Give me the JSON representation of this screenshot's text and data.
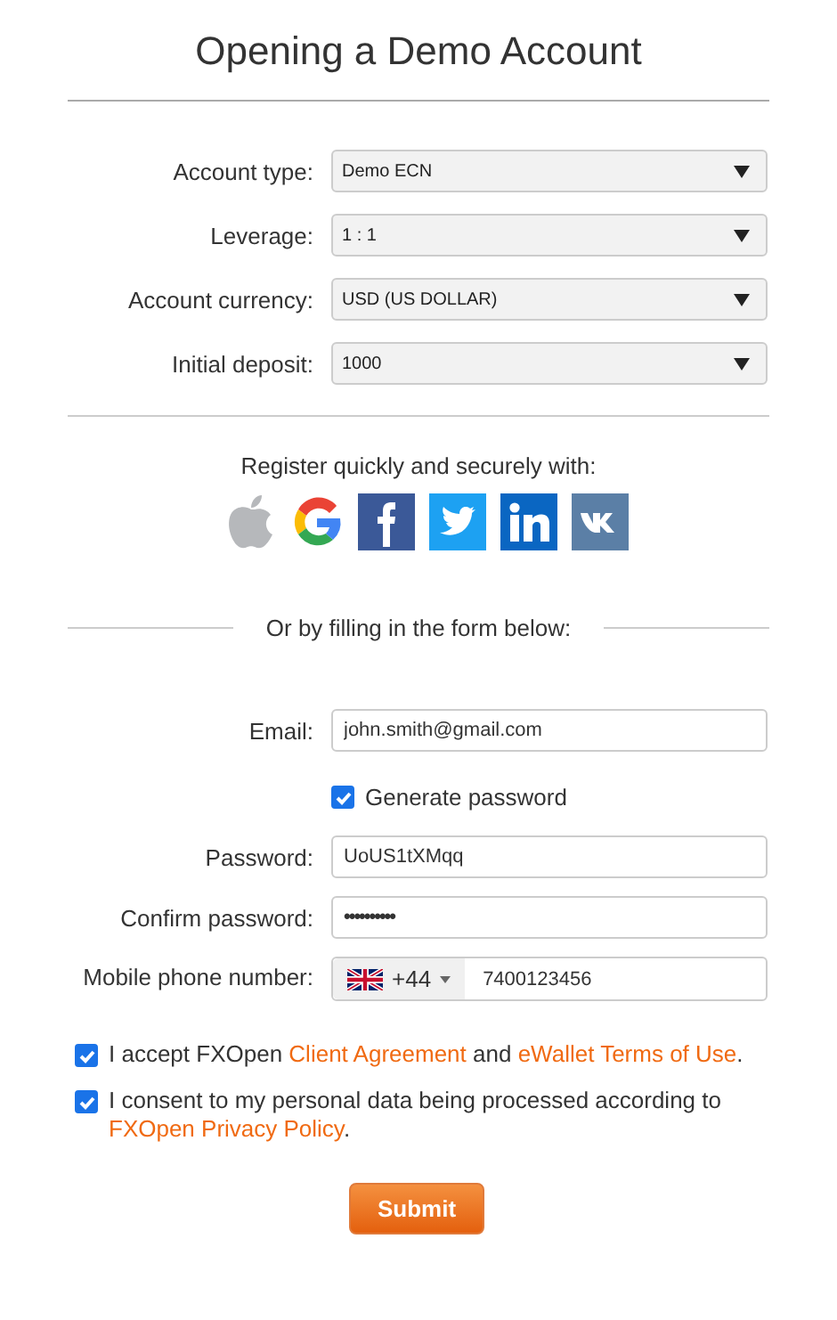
{
  "title": "Opening a Demo Account",
  "selects": [
    {
      "label": "Account type:",
      "value": "Demo ECN"
    },
    {
      "label": "Leverage:",
      "value": "1 : 1"
    },
    {
      "label": "Account currency:",
      "value": "USD (US DOLLAR)"
    },
    {
      "label": "Initial deposit:",
      "value": "1000"
    }
  ],
  "social": {
    "heading": "Register quickly and securely with:",
    "providers": [
      {
        "kind": "apple"
      },
      {
        "kind": "google"
      },
      {
        "kind": "facebook"
      },
      {
        "kind": "twitter"
      },
      {
        "kind": "linkedin"
      },
      {
        "kind": "vk"
      }
    ]
  },
  "separator": "Or by filling in the form below:",
  "email": {
    "label": "Email:",
    "value": "john.smith@gmail.com"
  },
  "generate_password": {
    "label": "Generate password",
    "checked": true
  },
  "password": {
    "label": "Password:",
    "value": "UoUS1tXMqq"
  },
  "confirm_password": {
    "label": "Confirm password:",
    "value": "••••••••••"
  },
  "phone": {
    "label": "Mobile phone number:",
    "code": "+44",
    "value": "7400123456"
  },
  "consents": [
    {
      "checked": true,
      "parts": [
        {
          "kind": "text",
          "text": "I accept FXOpen "
        },
        {
          "kind": "link",
          "text": "Client Agreement"
        },
        {
          "kind": "text",
          "text": " and "
        },
        {
          "kind": "link",
          "text": "eWallet Terms of Use"
        },
        {
          "kind": "text",
          "text": "."
        }
      ]
    },
    {
      "checked": true,
      "parts": [
        {
          "kind": "text",
          "text": "I consent to my personal data being processed according to "
        },
        {
          "kind": "link",
          "text": "FXOpen Privacy Policy"
        },
        {
          "kind": "text",
          "text": "."
        }
      ]
    }
  ],
  "submit": "Submit"
}
